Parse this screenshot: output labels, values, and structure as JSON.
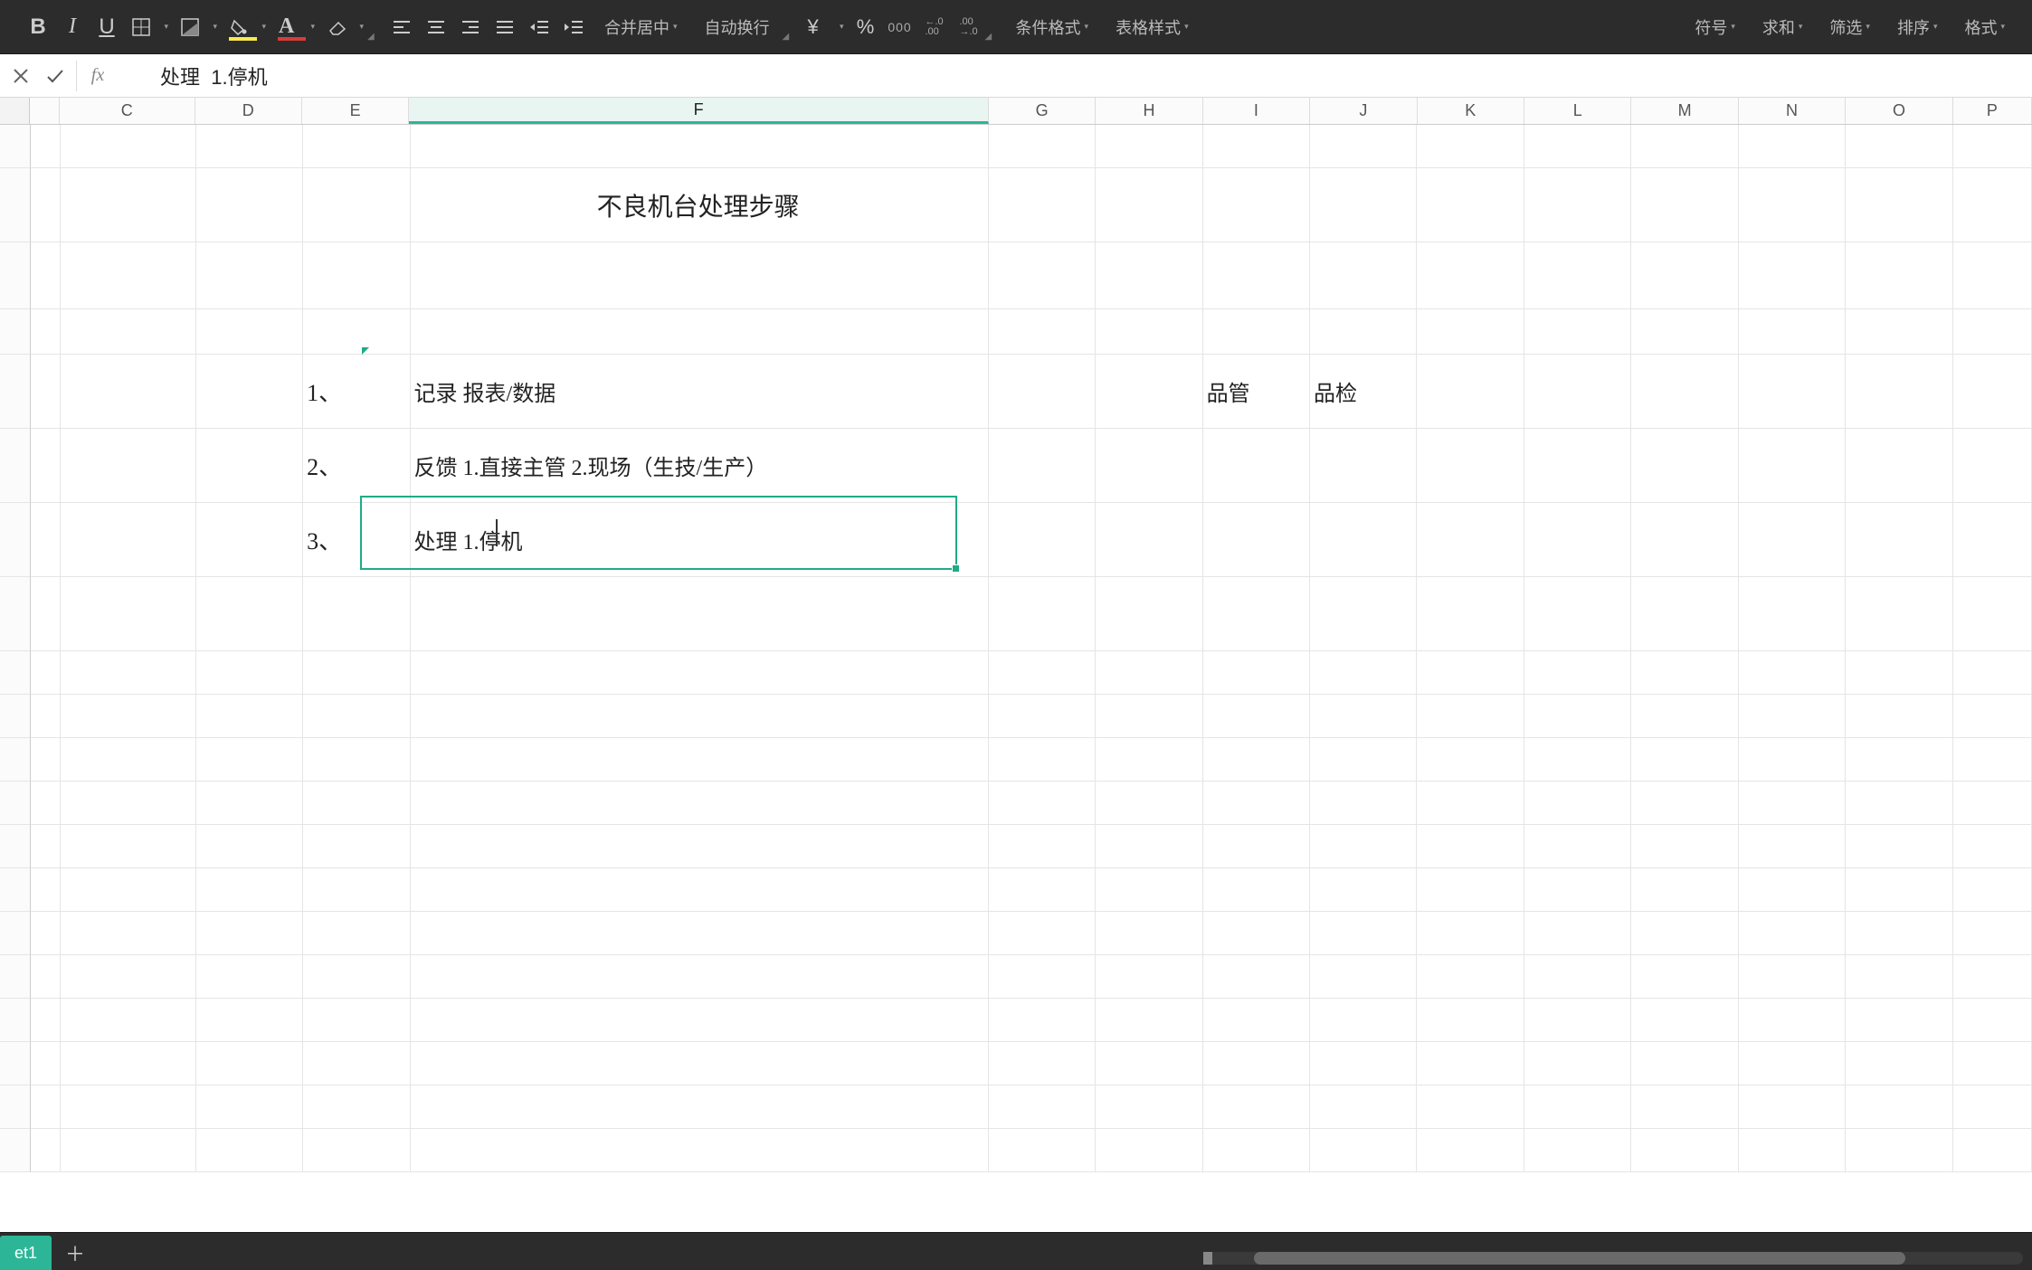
{
  "toolbar": {
    "bold": "B",
    "italic": "I",
    "underline": "U",
    "currency_symbol": "¥",
    "percent_symbol": "%",
    "thousands": "000",
    "decimal_inc": "←.0\n.00",
    "decimal_dec": ".00\n→.0",
    "merge_center": "合并居中",
    "wrap_text": "自动换行",
    "conditional_format": "条件格式",
    "table_style": "表格样式",
    "symbols": "符号",
    "sum": "求和",
    "filter": "筛选",
    "sort": "排序",
    "format": "格式"
  },
  "formula_bar": {
    "cancel": "×",
    "confirm": "✓",
    "fx": "fx",
    "value": "处理  1.停机"
  },
  "columns": [
    "C",
    "D",
    "E",
    "F",
    "G",
    "H",
    "I",
    "J",
    "K",
    "L",
    "M",
    "N",
    "O",
    "P"
  ],
  "active_col": "F",
  "col_widths": {
    "B": 34,
    "C": 96,
    "D": 76,
    "E": 76,
    "F": 412,
    "G": 76,
    "H": 76,
    "I": 76,
    "J": 76,
    "K": 76,
    "L": 76,
    "M": 76,
    "N": 76,
    "O": 76,
    "P": 58
  },
  "grid": {
    "title": "不良机台处理步骤",
    "row1_num": "1、",
    "row1_text": "记录 报表/数据",
    "row1_I": "品管",
    "row1_J": "品检",
    "row2_num": "2、",
    "row2_text": "反馈  1.直接主管  2.现场（生技/生产）",
    "row3_num": "3、",
    "row3_text": "处理  1.停机"
  },
  "sheet_tab": "et1"
}
